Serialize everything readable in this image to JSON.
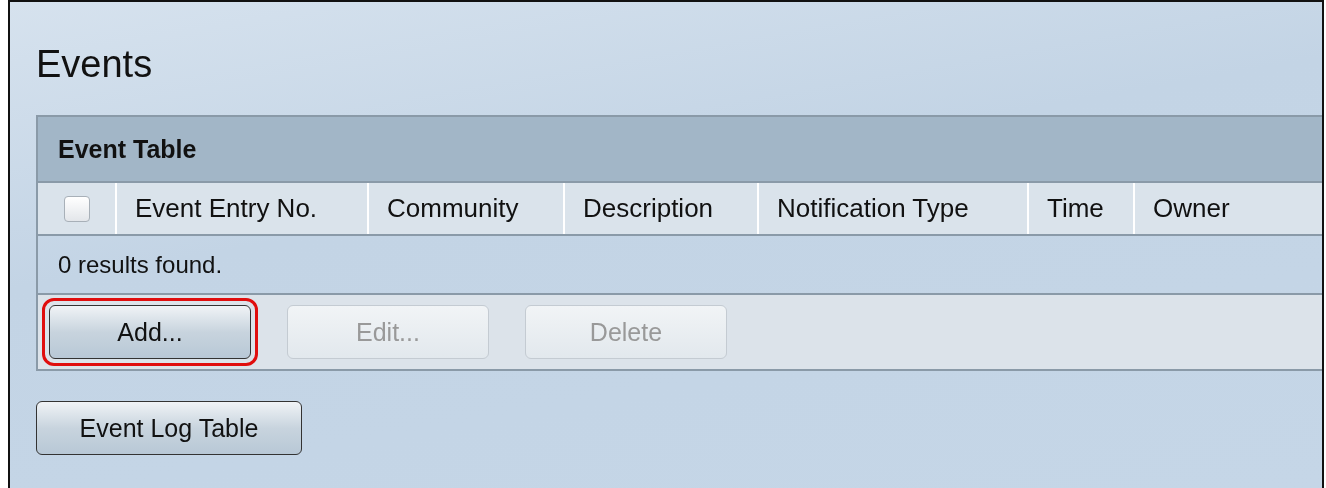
{
  "page": {
    "title": "Events"
  },
  "table": {
    "title": "Event Table",
    "select_all": {
      "checked": false
    },
    "columns": [
      "Event Entry No.",
      "Community",
      "Description",
      "Notification Type",
      "Time",
      "Owner"
    ],
    "status": "0 results found."
  },
  "table_buttons": [
    {
      "label": "Add...",
      "disabled": false,
      "highlighted": true
    },
    {
      "label": "Edit...",
      "disabled": true,
      "highlighted": false
    },
    {
      "label": "Delete",
      "disabled": true,
      "highlighted": false
    }
  ],
  "bottom_button": {
    "label": "Event Log Table",
    "disabled": false
  }
}
